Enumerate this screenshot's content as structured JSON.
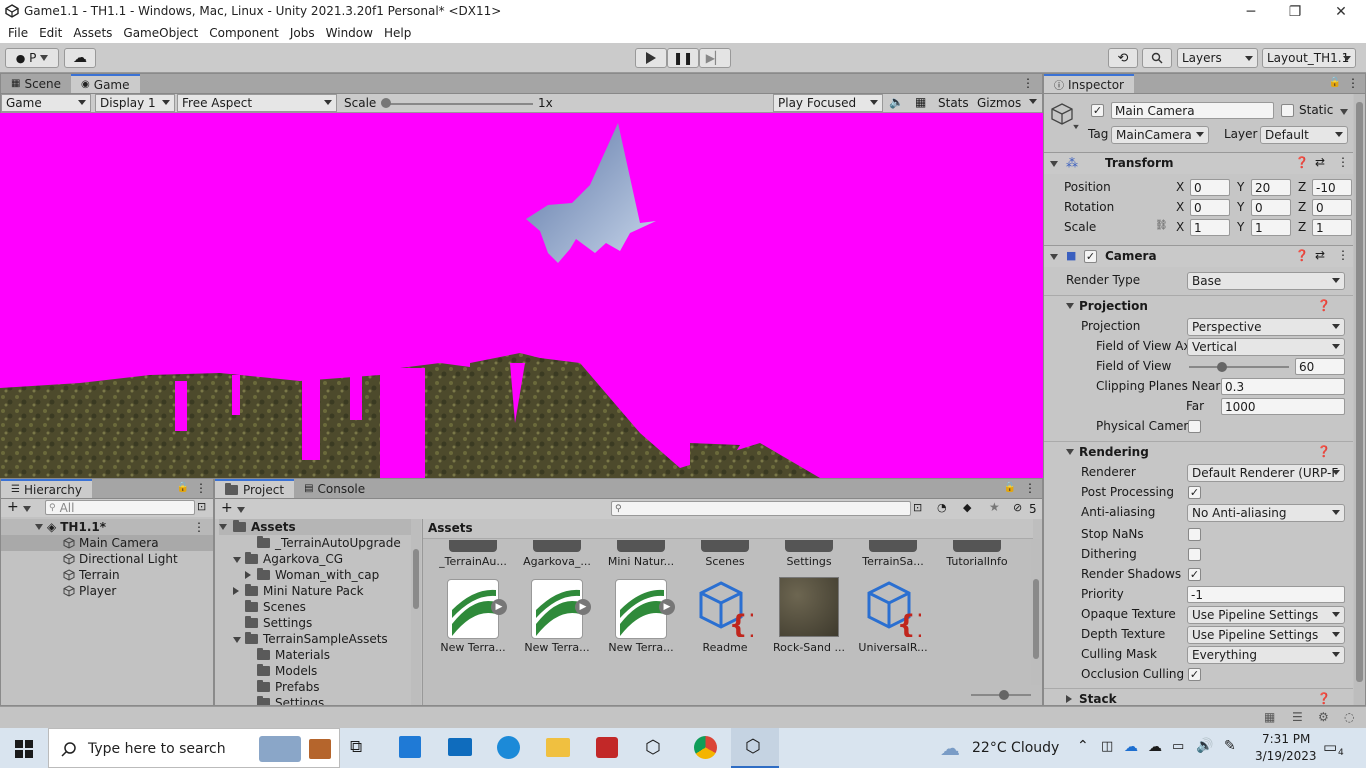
{
  "window": {
    "title": "Game1.1 - TH1.1 - Windows, Mac, Linux - Unity 2021.3.20f1 Personal* <DX11>",
    "minimize": "─",
    "restore": "❐",
    "close": "✕"
  },
  "menu": [
    "File",
    "Edit",
    "Assets",
    "GameObject",
    "Component",
    "Jobs",
    "Window",
    "Help"
  ],
  "toolbar": {
    "account_label": "P",
    "layers": "Layers",
    "layout": "Layout_TH1.1"
  },
  "scene_tabs": {
    "scene": "Scene",
    "game": "Game"
  },
  "game_toolbar": {
    "mode": "Game",
    "display": "Display 1",
    "aspect": "Free Aspect",
    "scale_label": "Scale",
    "scale_value": "1x",
    "play_focused": "Play Focused",
    "stats": "Stats",
    "gizmos": "Gizmos"
  },
  "hierarchy": {
    "tab": "Hierarchy",
    "search_placeholder": "All",
    "scene": "TH1.1*",
    "items": [
      "Main Camera",
      "Directional Light",
      "Terrain",
      "Player"
    ]
  },
  "project": {
    "tab": "Project",
    "console_tab": "Console",
    "count": "5",
    "tree": {
      "root": "Assets",
      "items": [
        {
          "label": "_TerrainAutoUpgrade",
          "indent": 1,
          "arrow": ""
        },
        {
          "label": "Agarkova_CG",
          "indent": 0,
          "arrow": "down"
        },
        {
          "label": "Woman_with_cap",
          "indent": 1,
          "arrow": "right"
        },
        {
          "label": "Mini Nature Pack",
          "indent": 0,
          "arrow": "right"
        },
        {
          "label": "Scenes",
          "indent": 0,
          "arrow": ""
        },
        {
          "label": "Settings",
          "indent": 0,
          "arrow": ""
        },
        {
          "label": "TerrainSampleAssets",
          "indent": 0,
          "arrow": "down"
        },
        {
          "label": "Materials",
          "indent": 1,
          "arrow": ""
        },
        {
          "label": "Models",
          "indent": 1,
          "arrow": ""
        },
        {
          "label": "Prefabs",
          "indent": 1,
          "arrow": ""
        },
        {
          "label": "Settings",
          "indent": 1,
          "arrow": ""
        }
      ]
    },
    "grid_header": "Assets",
    "top_row": [
      "_TerrainAu...",
      "Agarkova_...",
      "Mini Natur...",
      "Scenes",
      "Settings",
      "TerrainSa...",
      "TutorialInfo"
    ],
    "bottom_row": [
      "New Terra...",
      "New Terra...",
      "New Terra...",
      "Readme",
      "Rock-Sand ...",
      "UniversalR..."
    ]
  },
  "inspector": {
    "tab": "Inspector",
    "object_name": "Main Camera",
    "static_label": "Static",
    "tag_label": "Tag",
    "tag_value": "MainCamera",
    "layer_label": "Layer",
    "layer_value": "Default",
    "transform": {
      "title": "Transform",
      "position_label": "Position",
      "rotation_label": "Rotation",
      "scale_label": "Scale",
      "position": [
        "0",
        "20",
        "-10"
      ],
      "rotation": [
        "0",
        "0",
        "0"
      ],
      "scale": [
        "1",
        "1",
        "1"
      ],
      "axes": [
        "X",
        "Y",
        "Z"
      ]
    },
    "camera": {
      "title": "Camera",
      "render_type_label": "Render Type",
      "render_type": "Base",
      "projection_section": "Projection",
      "projection_label": "Projection",
      "projection": "Perspective",
      "fov_axis_label": "Field of View Ax",
      "fov_axis": "Vertical",
      "fov_label": "Field of View",
      "fov": "60",
      "fov_slider_fraction": 0.33,
      "clip_near_label": "Clipping Planes Near",
      "clip_near": "0.3",
      "clip_far_label": "Far",
      "clip_far": "1000",
      "physical_label": "Physical Camer",
      "rendering_section": "Rendering",
      "renderer_label": "Renderer",
      "renderer": "Default Renderer (URP-F",
      "post_processing_label": "Post Processing",
      "anti_aliasing_label": "Anti-aliasing",
      "anti_aliasing": "No Anti-aliasing",
      "stop_nans_label": "Stop NaNs",
      "dithering_label": "Dithering",
      "render_shadows_label": "Render Shadows",
      "priority_label": "Priority",
      "priority": "-1",
      "opaque_label": "Opaque Texture",
      "opaque": "Use Pipeline Settings",
      "depth_label": "Depth Texture",
      "depth": "Use Pipeline Settings",
      "culling_label": "Culling Mask",
      "culling": "Everything",
      "occlusion_label": "Occlusion Culling",
      "stack_label": "Stack"
    }
  },
  "taskbar": {
    "search_placeholder": "Type here to search",
    "weather": "22°C  Cloudy",
    "time": "7:31 PM",
    "date": "3/19/2023",
    "notifications": "4"
  }
}
